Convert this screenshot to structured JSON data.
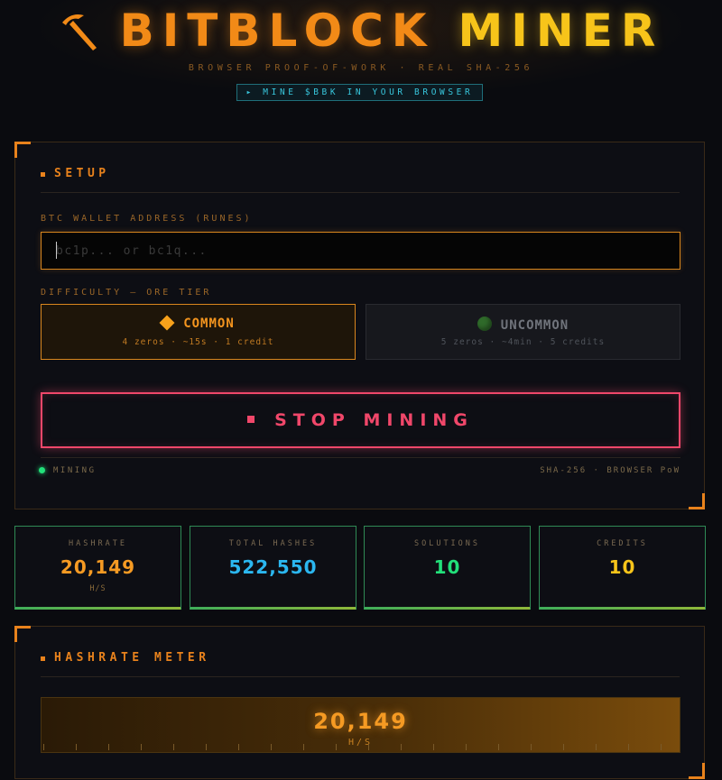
{
  "header": {
    "title_part1": "BITBLOCK",
    "title_part2": "MINER",
    "logo_icon": "pickaxe-icon",
    "subtitle": "BROWSER PROOF-OF-WORK · REAL SHA-256",
    "cta_label": "▸ MINE $BBK IN YOUR BROWSER"
  },
  "setup": {
    "title": "SETUP",
    "wallet_label": "BTC WALLET ADDRESS (RUNES)",
    "wallet_placeholder": "bc1p... or bc1q...",
    "wallet_value": "",
    "difficulty_label": "DIFFICULTY — ORE TIER",
    "tiers": [
      {
        "name": "COMMON",
        "desc": "4 zeros · ~15s · 1 credit",
        "icon": "orange-diamond-icon",
        "selected": true
      },
      {
        "name": "UNCOMMON",
        "desc": "5 zeros · ~4min · 5 credits",
        "icon": "green-circle-icon",
        "selected": false
      }
    ],
    "stop_label": "STOP MINING",
    "status": "MINING",
    "engine": "SHA-256 · BROWSER PoW"
  },
  "stats": [
    {
      "label": "HASHRATE",
      "value": "20,149",
      "unit": "H/S",
      "color": "#f59a23"
    },
    {
      "label": "TOTAL HASHES",
      "value": "522,550",
      "unit": "",
      "color": "#2bb7f0"
    },
    {
      "label": "SOLUTIONS",
      "value": "10",
      "unit": "",
      "color": "#22e07a"
    },
    {
      "label": "CREDITS",
      "value": "10",
      "unit": "",
      "color": "#f7c41a"
    }
  ],
  "meter": {
    "title": "HASHRATE METER",
    "value": "20,149",
    "unit": "H/S"
  },
  "colors": {
    "accent": "#e8821c",
    "danger": "#f0476a",
    "ok": "#22e07a",
    "cyan": "#38c6dc"
  }
}
